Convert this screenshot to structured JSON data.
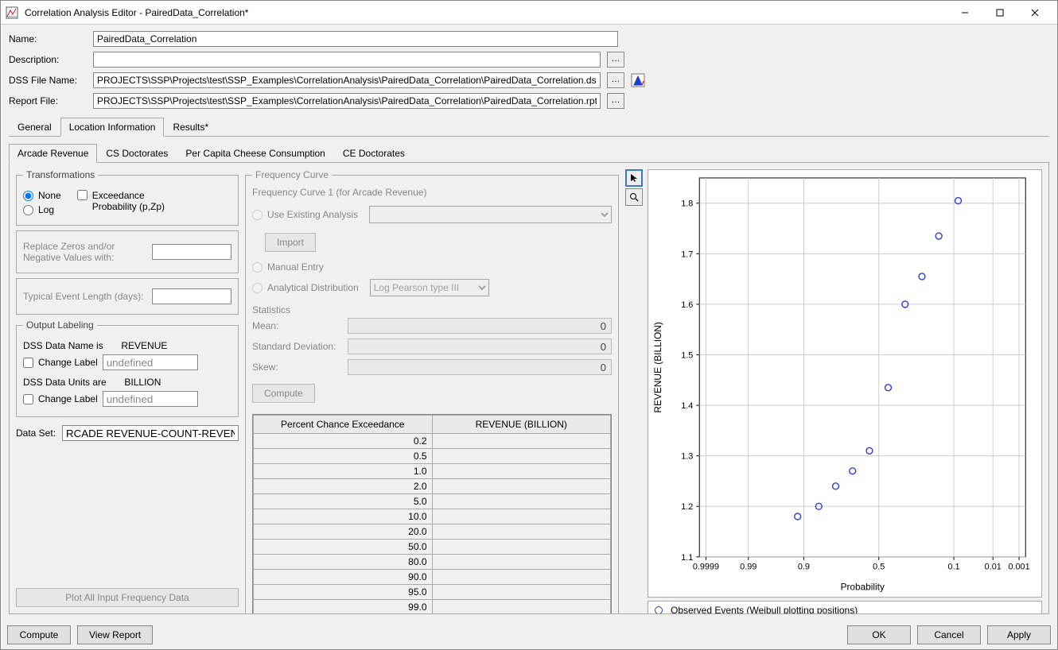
{
  "window": {
    "title": "Correlation Analysis Editor - PairedData_Correlation*"
  },
  "fields": {
    "name_label": "Name:",
    "name_value": "PairedData_Correlation",
    "desc_label": "Description:",
    "desc_value": "",
    "dss_label": "DSS File Name:",
    "dss_value": "PROJECTS\\SSP\\Projects\\test\\SSP_Examples\\CorrelationAnalysis\\PairedData_Correlation\\PairedData_Correlation.ds",
    "report_label": "Report File:",
    "report_value": "PROJECTS\\SSP\\Projects\\test\\SSP_Examples\\CorrelationAnalysis\\PairedData_Correlation\\PairedData_Correlation.rpt"
  },
  "tabs": {
    "general": "General",
    "location": "Location Information",
    "results": "Results*"
  },
  "subtabs": {
    "arcade": "Arcade Revenue",
    "cs": "CS Doctorates",
    "cheese": "Per Capita Cheese Consumption",
    "ce": "CE Doctorates"
  },
  "transformations": {
    "legend": "Transformations",
    "none": "None",
    "log": "Log",
    "exceed": "Exceedance Probability (p,Zp)",
    "replace_label": "Replace Zeros and/or Negative Values with:",
    "typical_label": "Typical Event Length (days):"
  },
  "output": {
    "legend": "Output Labeling",
    "name_is": "DSS Data Name is",
    "name_val": "REVENUE",
    "change_label": "Change Label",
    "undef": "undefined",
    "units_are": "DSS Data Units are",
    "units_val": "BILLION"
  },
  "dataset": {
    "label": "Data Set:",
    "value": "RCADE REVENUE-COUNT-REVENUE"
  },
  "plot_all_btn": "Plot All Input Frequency Data",
  "freq": {
    "legend": "Frequency Curve",
    "sub": "Frequency Curve 1 (for Arcade Revenue)",
    "use_existing": "Use Existing Analysis",
    "import": "Import",
    "manual": "Manual Entry",
    "analytical": "Analytical Distribution",
    "dist_option": "Log Pearson type III",
    "stats_label": "Statistics",
    "mean": "Mean:",
    "sd": "Standard Deviation:",
    "skew": "Skew:",
    "zero": "0",
    "compute": "Compute",
    "table_h1": "Percent Chance Exceedance",
    "table_h2": "REVENUE (BILLION)",
    "rows": [
      "0.2",
      "0.5",
      "1.0",
      "2.0",
      "5.0",
      "10.0",
      "20.0",
      "50.0",
      "80.0",
      "90.0",
      "95.0",
      "99.0"
    ]
  },
  "chart": {
    "ylabel": "REVENUE (BILLION)",
    "xlabel": "Probability",
    "legend": "Observed Events (Weibull plotting positions)"
  },
  "chart_data": {
    "type": "scatter",
    "title": "",
    "xlabel": "Probability",
    "ylabel": "REVENUE (BILLION)",
    "ylim": [
      1.1,
      1.85
    ],
    "yticks": [
      1.1,
      1.2,
      1.3,
      1.4,
      1.5,
      1.6,
      1.7,
      1.8
    ],
    "xticks_labels": [
      "0.9999",
      "0.99",
      "0.9",
      "0.5",
      "0.1",
      "0.01",
      "0.001"
    ],
    "series": [
      {
        "name": "Observed Events (Weibull plotting positions)",
        "points": [
          {
            "p": 0.91,
            "y": 1.18
          },
          {
            "p": 0.82,
            "y": 1.2
          },
          {
            "p": 0.73,
            "y": 1.24
          },
          {
            "p": 0.64,
            "y": 1.27
          },
          {
            "p": 0.55,
            "y": 1.31
          },
          {
            "p": 0.45,
            "y": 1.435
          },
          {
            "p": 0.36,
            "y": 1.6
          },
          {
            "p": 0.27,
            "y": 1.655
          },
          {
            "p": 0.18,
            "y": 1.735
          },
          {
            "p": 0.09,
            "y": 1.805
          }
        ]
      }
    ]
  },
  "footer": {
    "compute": "Compute",
    "view_report": "View Report",
    "ok": "OK",
    "cancel": "Cancel",
    "apply": "Apply"
  }
}
